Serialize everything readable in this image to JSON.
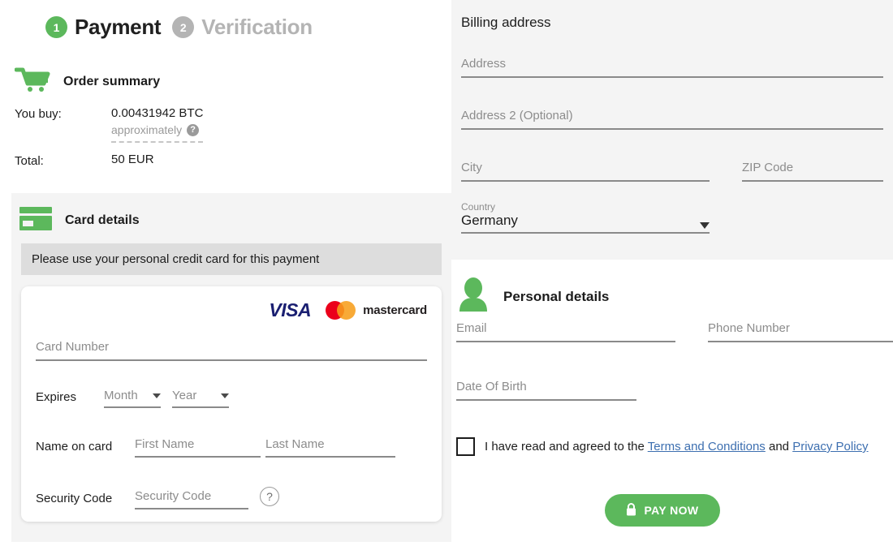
{
  "steps": [
    {
      "number": "1",
      "label": "Payment",
      "state": "active"
    },
    {
      "number": "2",
      "label": "Verification",
      "state": "inactive"
    }
  ],
  "order_summary": {
    "icon": "shopping-cart-icon",
    "title": "Order summary",
    "you_buy_label": "You buy:",
    "you_buy_amount": "0.00431942 BTC",
    "you_buy_note": "approximately",
    "help_icon": "help-circle-icon",
    "total_label": "Total:",
    "total_amount": "50 EUR"
  },
  "card_details": {
    "icon": "credit-card-icon",
    "title": "Card details",
    "notice": "Please use your personal credit card for this payment",
    "brands": {
      "visa": "VISA",
      "mastercard": "mastercard"
    },
    "card_number_placeholder": "Card Number",
    "expires_label": "Expires",
    "month_placeholder": "Month",
    "year_placeholder": "Year",
    "name_on_card_label": "Name on card",
    "first_name_placeholder": "First Name",
    "last_name_placeholder": "Last Name",
    "security_code_label": "Security Code",
    "security_code_placeholder": "Security Code",
    "security_help_icon": "help-circle-outline-icon"
  },
  "billing": {
    "title": "Billing address",
    "address_placeholder": "Address",
    "address2_placeholder": "Address 2 (Optional)",
    "city_placeholder": "City",
    "zip_placeholder": "ZIP Code",
    "country_label": "Country",
    "country_value": "Germany",
    "country_caret_icon": "chevron-down-icon"
  },
  "personal": {
    "icon": "person-icon",
    "title": "Personal details",
    "email_placeholder": "Email",
    "phone_placeholder": "Phone Number",
    "dob_placeholder": "Date Of Birth",
    "terms_prefix": "I have read and agreed to the",
    "terms_link": "Terms and Conditions",
    "terms_and": "and",
    "privacy_link": "Privacy Policy",
    "pay_button_label": "PAY NOW",
    "pay_button_icon": "lock-icon"
  },
  "colors": {
    "brand_green": "#5cb85c",
    "panel_gray": "#f4f4f4",
    "notice_gray": "#dddddd",
    "muted_text": "#8c8c8c",
    "link_blue": "#3d6fb0",
    "visa_blue": "#1a1f71",
    "mc_red": "#eb001b",
    "mc_yellow": "#f79e1b"
  }
}
